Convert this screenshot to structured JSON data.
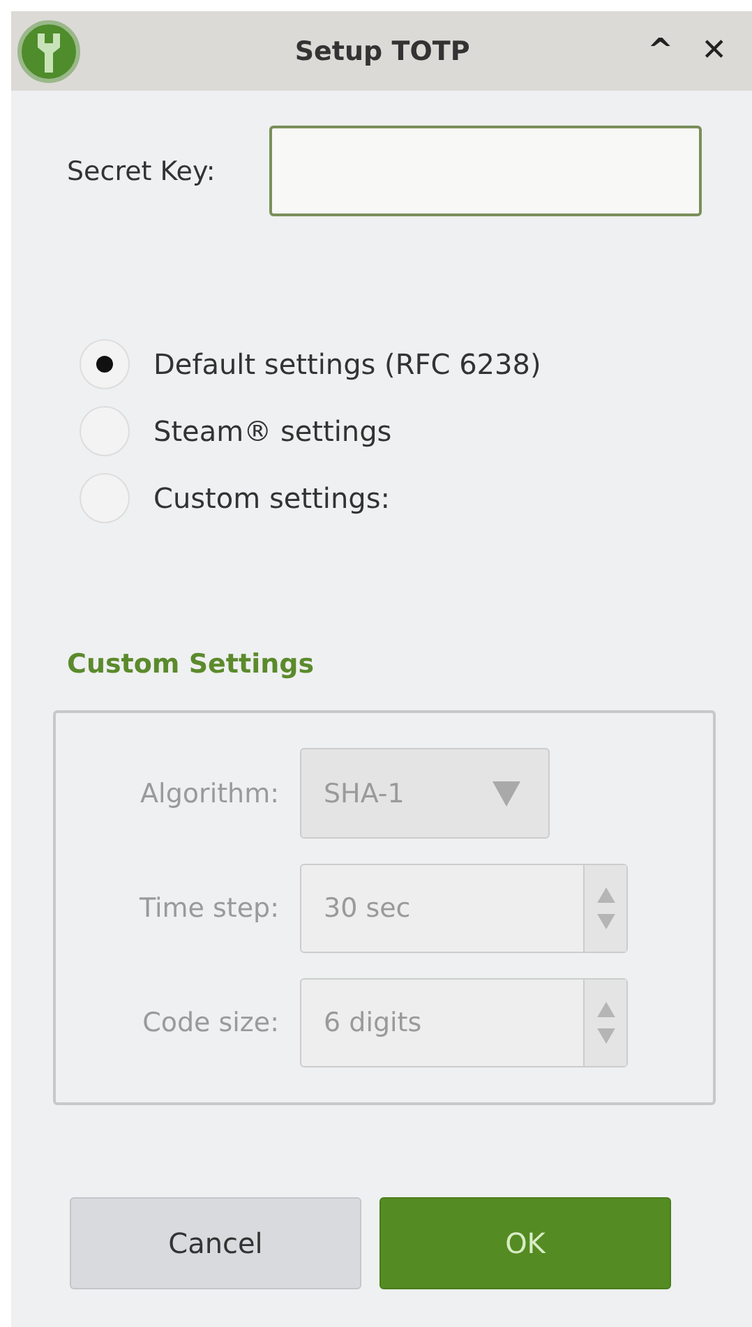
{
  "window": {
    "title": "Setup TOTP",
    "buttons": [
      "^",
      "✕"
    ]
  },
  "secret_key": {
    "label": "Secret Key:"
  },
  "options": [
    {
      "label": "Default settings (RFC 6238)",
      "selected": true
    },
    {
      "label": "Steam® settings",
      "selected": false
    },
    {
      "label": "Custom settings:",
      "selected": false
    }
  ],
  "custom_settings": {
    "title": "Custom Settings",
    "disabled": true,
    "fields": [
      {
        "kind": "combo",
        "label": "Algorithm:",
        "value": "SHA-1"
      },
      {
        "kind": "spin",
        "label": "Time step:",
        "value": "30 sec"
      },
      {
        "kind": "spin",
        "label": "Code size:",
        "value": "6 digits"
      }
    ]
  },
  "buttons": [
    {
      "label": "Cancel",
      "kind": "secondary"
    },
    {
      "label": "OK",
      "kind": "primary"
    }
  ]
}
